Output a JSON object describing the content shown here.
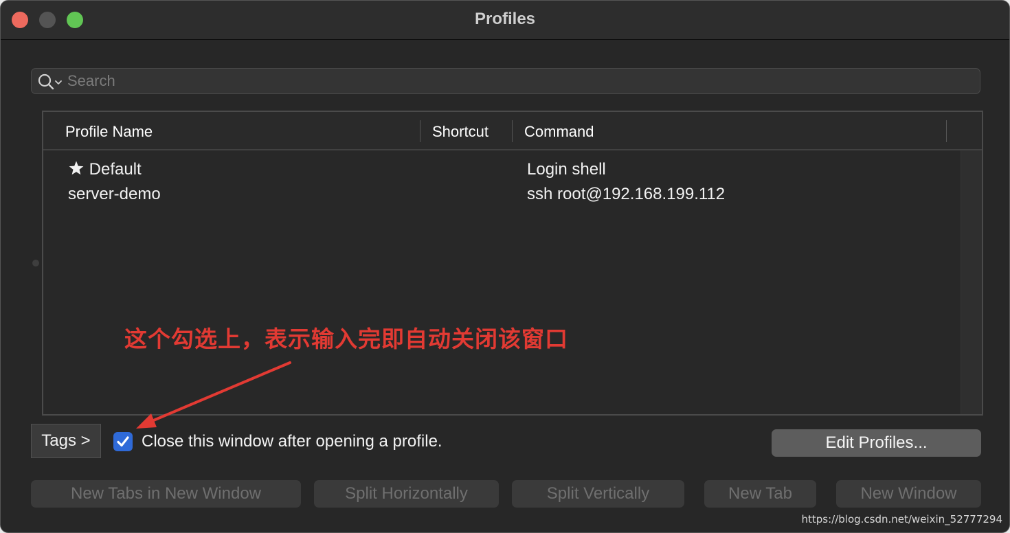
{
  "window": {
    "title": "Profiles"
  },
  "search": {
    "placeholder": "Search",
    "value": ""
  },
  "table": {
    "columns": [
      "Profile Name",
      "Shortcut",
      "Command"
    ],
    "rows": [
      {
        "name": "Default",
        "shortcut": "",
        "command": "Login shell",
        "is_default": true
      },
      {
        "name": "server-demo",
        "shortcut": "",
        "command": "ssh root@192.168.199.112",
        "is_default": false
      }
    ]
  },
  "annotation": {
    "text": "这个勾选上，表示输入完即自动关闭该窗口",
    "color": "#e23a33"
  },
  "footer": {
    "tags_label": "Tags >",
    "close_checkbox_label": "Close this window after opening a profile.",
    "close_checkbox_checked": true,
    "edit_profiles_label": "Edit Profiles..."
  },
  "actions": {
    "new_tabs_in_new_window": "New Tabs in New Window",
    "split_horizontally": "Split Horizontally",
    "split_vertically": "Split Vertically",
    "new_tab": "New Tab",
    "new_window": "New Window"
  },
  "watermark": "https://blog.csdn.net/weixin_52777294",
  "colors": {
    "window_bg": "#272727",
    "checkbox_accent": "#2f6ad8",
    "close_light": "#ed6a5e",
    "max_light": "#61c554"
  }
}
